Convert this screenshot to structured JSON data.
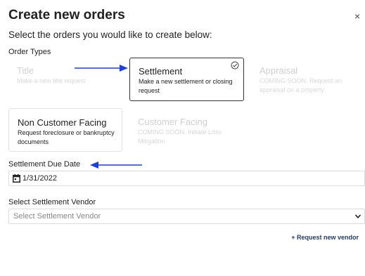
{
  "dialog": {
    "title": "Create new orders",
    "close_symbol": "×",
    "subtitle": "Select the orders you would like to create below:",
    "order_types_label": "Order Types"
  },
  "order_types": [
    {
      "name": "Title",
      "description": "Make a new title request",
      "state": "disabled"
    },
    {
      "name": "Settlement",
      "description": "Make a new settlement or closing request",
      "state": "selected"
    },
    {
      "name": "Appraisal",
      "description": "COMING SOON. Request an appraisal on a property",
      "state": "disabled"
    },
    {
      "name": "Non Customer Facing",
      "description": "Request foreclosure or bankruptcy documents",
      "state": "enabled"
    },
    {
      "name": "Customer Facing",
      "description": "COMING SOON. Initiate Loss Mitigation",
      "state": "disabled"
    }
  ],
  "due_date": {
    "label": "Settlement Due Date",
    "value": "1/31/2022",
    "icon": "calendar-icon"
  },
  "vendor": {
    "label": "Select Settlement Vendor",
    "placeholder": "Select Settlement Vendor",
    "icon": "chevron-down-icon"
  },
  "request_vendor_link": "+ Request new vendor",
  "colors": {
    "annotation_arrow": "#1a3fe0",
    "check": "#4a4a4a",
    "link": "#1f3a6b"
  }
}
